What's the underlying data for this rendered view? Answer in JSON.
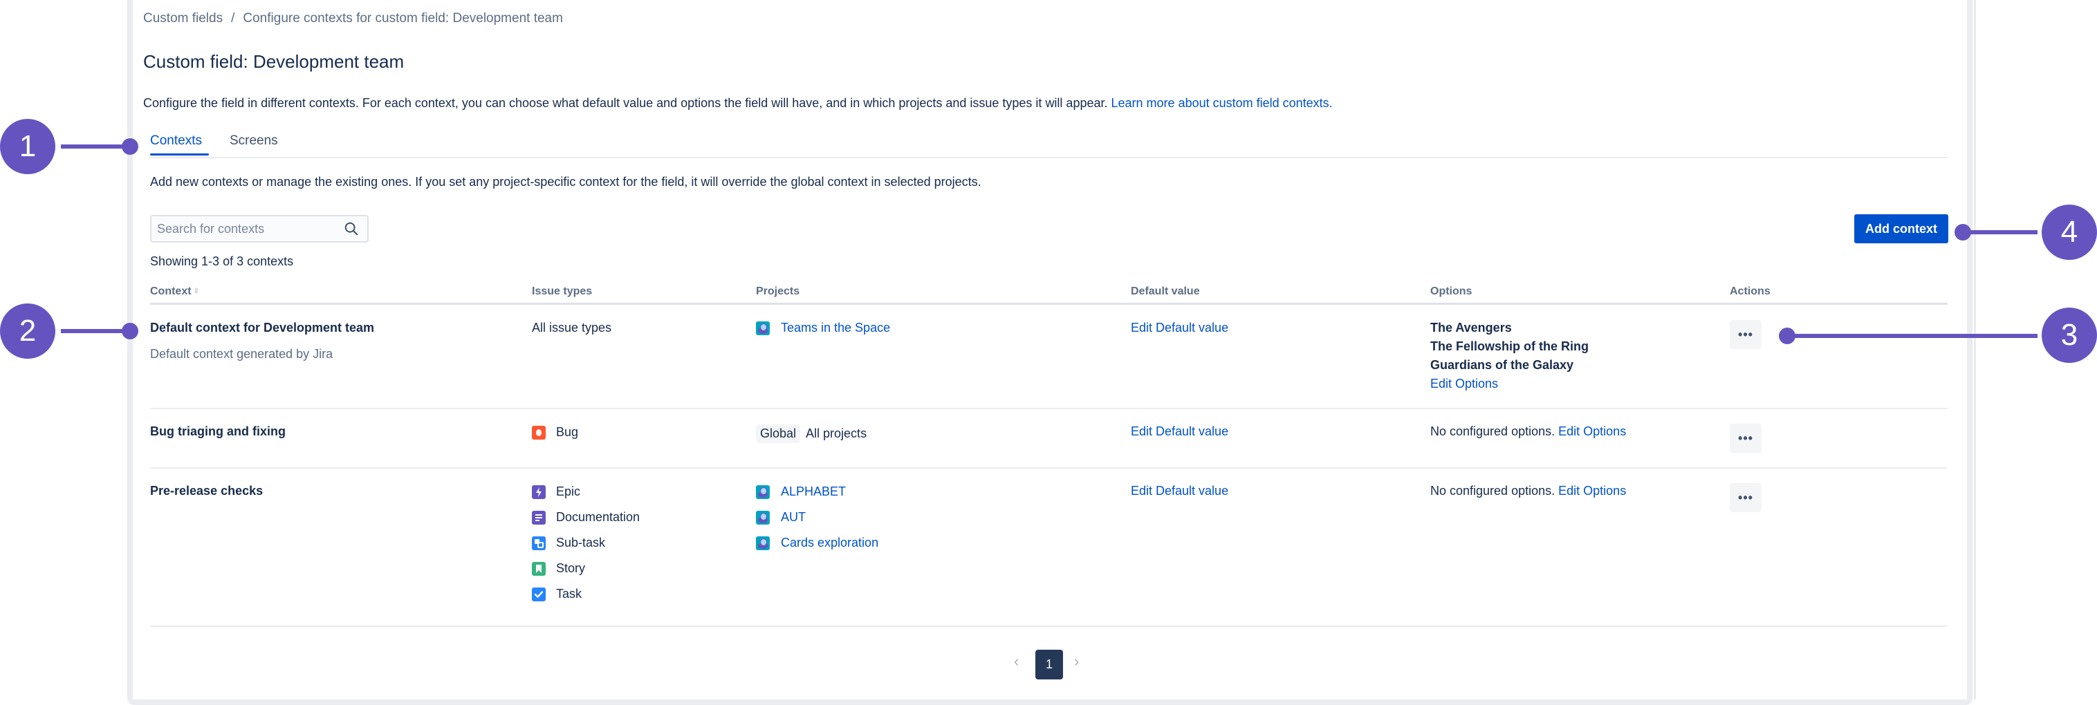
{
  "breadcrumb": {
    "items": [
      "Custom fields",
      "Configure contexts for custom field: Development team"
    ],
    "separator": "/"
  },
  "page": {
    "title": "Custom field: Development team",
    "description": "Configure the field in different contexts. For each context, you can choose what default value and options the field will have, and in which projects and issue types it will appear.",
    "learn_more": "Learn more about custom field contexts."
  },
  "tabs": [
    {
      "label": "Contexts",
      "active": true
    },
    {
      "label": "Screens",
      "active": false
    }
  ],
  "helper_text": "Add new contexts or manage the existing ones. If you set any project-specific context for the field, it will override the global context in selected projects.",
  "search": {
    "placeholder": "Search for contexts",
    "value": ""
  },
  "add_button": "Add context",
  "showing": "Showing 1-3 of 3 contexts",
  "table": {
    "headers": [
      "Context",
      "Issue types",
      "Projects",
      "Default value",
      "Options",
      "Actions"
    ],
    "rows": [
      {
        "name": "Default context for Development team",
        "description": "Default context generated by Jira",
        "issue_types": [
          {
            "label": "All issue types",
            "icon": "none"
          }
        ],
        "projects": [
          {
            "label": "Teams in the Space",
            "icon": "project-avatar"
          }
        ],
        "default_value": "Edit Default value",
        "options": [
          "The Avengers",
          "The Fellowship of the Ring",
          "Guardians of the Galaxy"
        ],
        "options_empty": "",
        "edit_options": "Edit Options",
        "actions": "•••"
      },
      {
        "name": "Bug triaging and fixing",
        "description": "",
        "issue_types": [
          {
            "label": "Bug",
            "icon": "bug-icon"
          }
        ],
        "projects_global": {
          "lozenge": "Global",
          "label": "All projects"
        },
        "default_value": "Edit Default value",
        "options": [],
        "options_empty": "No configured options.",
        "edit_options": "Edit Options",
        "actions": "•••"
      },
      {
        "name": "Pre-release checks",
        "description": "",
        "issue_types": [
          {
            "label": "Epic",
            "icon": "epic-icon"
          },
          {
            "label": "Documentation",
            "icon": "documentation-icon"
          },
          {
            "label": "Sub-task",
            "icon": "subtask-icon"
          },
          {
            "label": "Story",
            "icon": "story-icon"
          },
          {
            "label": "Task",
            "icon": "task-icon"
          }
        ],
        "projects": [
          {
            "label": "ALPHABET",
            "icon": "project-avatar"
          },
          {
            "label": "AUT",
            "icon": "project-avatar"
          },
          {
            "label": "Cards exploration",
            "icon": "project-avatar"
          }
        ],
        "default_value": "Edit Default value",
        "options": [],
        "options_empty": "No configured options.",
        "edit_options": "Edit Options",
        "actions": "•••"
      }
    ]
  },
  "pagination": {
    "prev": "‹",
    "current": "1",
    "next": "›"
  },
  "annotations": [
    "1",
    "2",
    "3",
    "4"
  ],
  "colors": {
    "primary": "#0052cc",
    "annotation": "#6554c0",
    "text": "#172b4d",
    "subtle": "#5e6c84",
    "bug": "#ff5630",
    "epic": "#6554c0",
    "documentation": "#6554c0",
    "subtask": "#2684ff",
    "story": "#36b37e",
    "task": "#2684ff",
    "page_active": "#253858"
  }
}
